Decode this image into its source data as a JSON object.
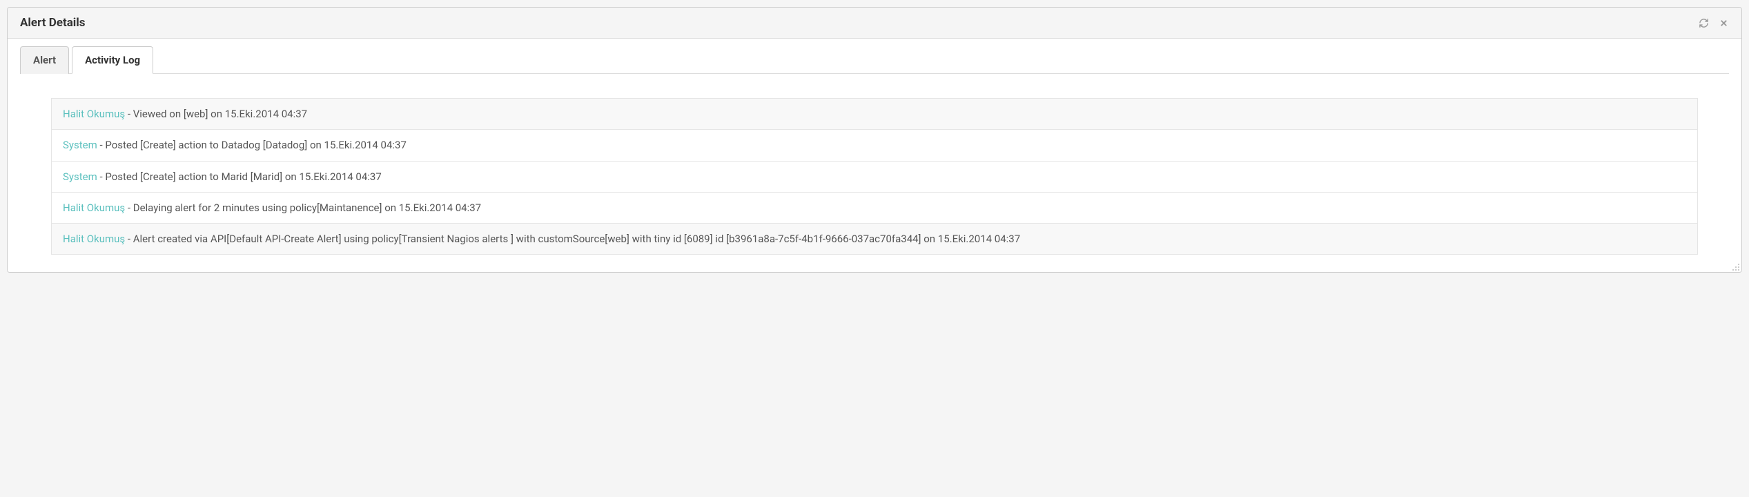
{
  "header": {
    "title": "Alert Details"
  },
  "tabs": [
    {
      "label": "Alert",
      "active": false
    },
    {
      "label": "Activity Log",
      "active": true
    }
  ],
  "logs": [
    {
      "actor": "Halit Okumuş",
      "text": " - Viewed on [web] on 15.Eki.2014 04:37"
    },
    {
      "actor": "System",
      "text": " - Posted [Create] action to Datadog [Datadog] on 15.Eki.2014 04:37"
    },
    {
      "actor": "System",
      "text": " - Posted [Create] action to Marid [Marid] on 15.Eki.2014 04:37"
    },
    {
      "actor": "Halit Okumuş",
      "text": " - Delaying alert for 2 minutes using policy[Maintanence] on 15.Eki.2014 04:37"
    },
    {
      "actor": "Halit Okumuş",
      "text": " - Alert created via API[Default API-Create Alert] using policy[Transient Nagios alerts ] with customSource[web] with tiny id [6089] id [b3961a8a-7c5f-4b1f-9666-037ac70fa344] on 15.Eki.2014 04:37"
    }
  ]
}
